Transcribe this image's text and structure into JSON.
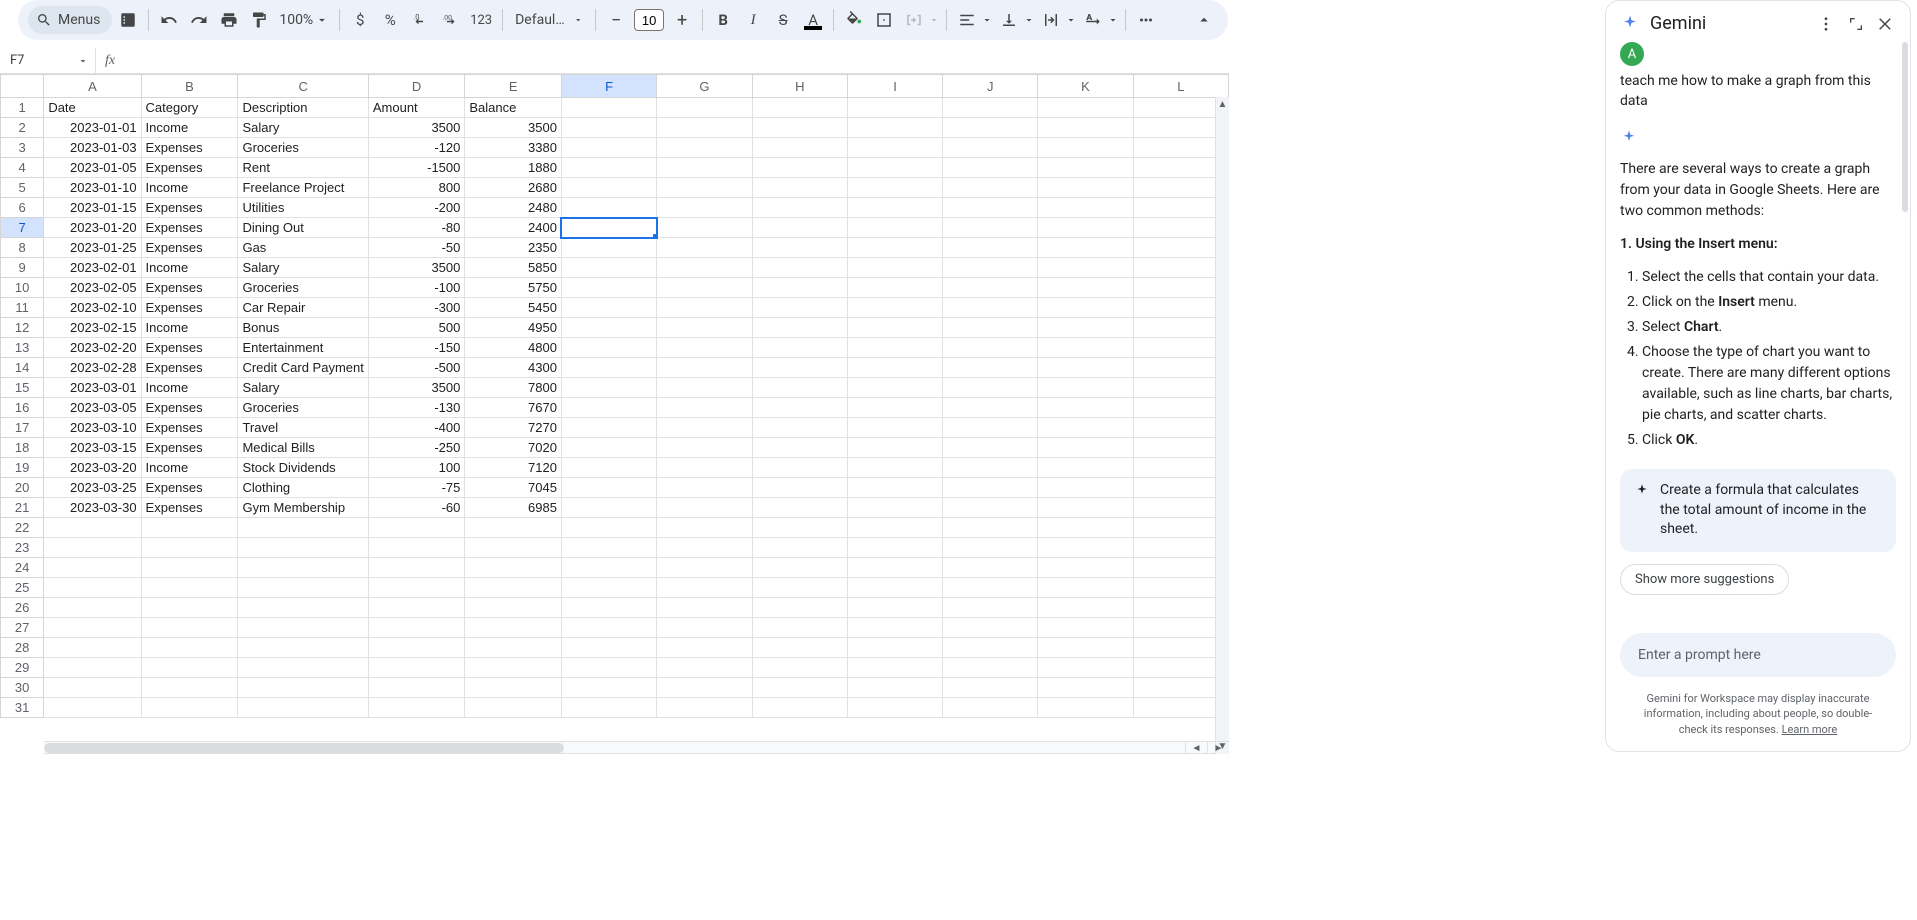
{
  "toolbar": {
    "menus_label": "Menus",
    "zoom": "100%",
    "font_name": "Defaul…",
    "font_size": "10",
    "format_123": "123"
  },
  "name_box": "F7",
  "columns": [
    "A",
    "B",
    "C",
    "D",
    "E",
    "F",
    "G",
    "H",
    "I",
    "J",
    "K",
    "L"
  ],
  "selected_col": "F",
  "selected_row": 7,
  "headers": [
    "Date",
    "Category",
    "Description",
    "Amount",
    "Balance"
  ],
  "rows": [
    [
      "2023-01-01",
      "Income",
      "Salary",
      "3500",
      "3500"
    ],
    [
      "2023-01-03",
      "Expenses",
      "Groceries",
      "-120",
      "3380"
    ],
    [
      "2023-01-05",
      "Expenses",
      "Rent",
      "-1500",
      "1880"
    ],
    [
      "2023-01-10",
      "Income",
      "Freelance Project",
      "800",
      "2680"
    ],
    [
      "2023-01-15",
      "Expenses",
      "Utilities",
      "-200",
      "2480"
    ],
    [
      "2023-01-20",
      "Expenses",
      "Dining Out",
      "-80",
      "2400"
    ],
    [
      "2023-01-25",
      "Expenses",
      "Gas",
      "-50",
      "2350"
    ],
    [
      "2023-02-01",
      "Income",
      "Salary",
      "3500",
      "5850"
    ],
    [
      "2023-02-05",
      "Expenses",
      "Groceries",
      "-100",
      "5750"
    ],
    [
      "2023-02-10",
      "Expenses",
      "Car Repair",
      "-300",
      "5450"
    ],
    [
      "2023-02-15",
      "Income",
      "Bonus",
      "500",
      "4950"
    ],
    [
      "2023-02-20",
      "Expenses",
      "Entertainment",
      "-150",
      "4800"
    ],
    [
      "2023-02-28",
      "Expenses",
      "Credit Card Payment",
      "-500",
      "4300"
    ],
    [
      "2023-03-01",
      "Income",
      "Salary",
      "3500",
      "7800"
    ],
    [
      "2023-03-05",
      "Expenses",
      "Groceries",
      "-130",
      "7670"
    ],
    [
      "2023-03-10",
      "Expenses",
      "Travel",
      "-400",
      "7270"
    ],
    [
      "2023-03-15",
      "Expenses",
      "Medical Bills",
      "-250",
      "7020"
    ],
    [
      "2023-03-20",
      "Income",
      "Stock Dividends",
      "100",
      "7120"
    ],
    [
      "2023-03-25",
      "Expenses",
      "Clothing",
      "-75",
      "7045"
    ],
    [
      "2023-03-30",
      "Expenses",
      "Gym Membership",
      "-60",
      "6985"
    ]
  ],
  "empty_rows": 10,
  "gemini": {
    "title": "Gemini",
    "avatar_initial": "A",
    "user_message": "teach me how to make a graph from this data",
    "intro": "There are several ways to create a graph from your data in Google Sheets. Here are two common methods:",
    "section_heading": "1. Using the Insert menu:",
    "steps_html": [
      "Select the cells that contain your data.",
      "Click on the <strong>Insert</strong> menu.",
      "Select <strong>Chart</strong>.",
      "Choose the type of chart you want to create. There are many different options available, such as line charts, bar charts, pie charts, and scatter charts.",
      "Click <strong>OK</strong>."
    ],
    "suggestion": "Create a formula that calculates the total amount of income in the sheet.",
    "show_more": "Show more suggestions",
    "prompt_placeholder": "Enter a prompt here",
    "disclaimer": "Gemini for Workspace may display inaccurate information, including about people, so double-check its responses.",
    "learn_more": "Learn more"
  }
}
